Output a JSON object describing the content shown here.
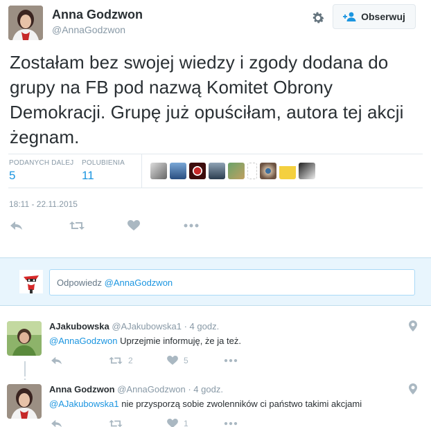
{
  "tweet": {
    "author_name": "Anna Godzwon",
    "author_handle": "@AnnaGodzwon",
    "follow_label": "Obserwuj",
    "text": "Zostałam bez swojej wiedzy i zgody dodana do grupy na FB pod nazwą Komitet Obrony Demokracji. Grupę już opuściłam, autora tej akcji żegnam.",
    "retweets_label": "PODANYCH DALEJ",
    "retweets_count": "5",
    "likes_label": "POLUBIENIA",
    "likes_count": "11",
    "timestamp": "18:11 - 22.11.2015",
    "liker_avatars": [
      "liker-avatar",
      "liker-avatar",
      "liker-avatar",
      "liker-avatar",
      "liker-avatar",
      "liker-avatar",
      "liker-avatar",
      "liker-avatar",
      "liker-avatar"
    ],
    "icons": {
      "settings": "gear-icon",
      "follow": "person-add-icon",
      "reply": "reply-icon",
      "retweet": "retweet-icon",
      "like": "heart-icon",
      "more": "more-icon"
    }
  },
  "reply_box": {
    "prefix": "Odpowiedz",
    "mention": "@AnnaGodzwon"
  },
  "replies": [
    {
      "name": "AJakubowska",
      "handle": "@AJakubowska1",
      "time": "· 4 godz.",
      "mention": "@AnnaGodzwon",
      "text": "Uprzejmie informuję, że ja też.",
      "retweets": "2",
      "likes": "5"
    },
    {
      "name": "Anna Godzwon",
      "handle": "@AnnaGodzwon",
      "time": "· 4 godz.",
      "mention": "@AJakubowska1",
      "text": "nie przysporzą sobie zwolenników ci państwo takimi akcjami",
      "retweets": "",
      "likes": "1"
    }
  ],
  "colors": {
    "accent": "#1b95e0",
    "muted": "#8899a6",
    "text": "#292f33",
    "reply_bg": "#e8f5fd"
  }
}
